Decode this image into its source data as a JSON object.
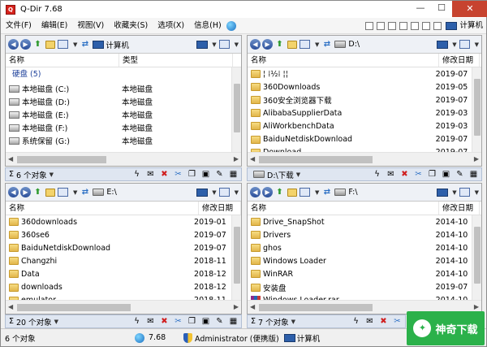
{
  "window": {
    "title": "Q-Dir 7.68",
    "close_glyph": "✕",
    "min_glyph": "—",
    "max_glyph": "☐"
  },
  "menu": [
    "文件(F)",
    "编辑(E)",
    "视图(V)",
    "收藏夹(S)",
    "选项(X)",
    "信息(H)"
  ],
  "menu_right_label": "计算机",
  "panes": [
    {
      "id": "top-left",
      "path": "计算机",
      "columns": [
        "名称",
        "类型"
      ],
      "group": "硬盘 (5)",
      "rows": [
        [
          "本地磁盘 (C:)",
          "本地磁盘"
        ],
        [
          "本地磁盘 (D:)",
          "本地磁盘"
        ],
        [
          "本地磁盘 (E:)",
          "本地磁盘"
        ],
        [
          "本地磁盘 (F:)",
          "本地磁盘"
        ],
        [
          "系统保留 (G:)",
          "本地磁盘"
        ]
      ],
      "status": "6 个对象"
    },
    {
      "id": "top-right",
      "path": "D:\\",
      "columns": [
        "名称",
        "修改日期"
      ],
      "rows": [
        [
          "¦ ⁞½⁞ ¦¦",
          "2019-07"
        ],
        [
          "360Downloads",
          "2019-05"
        ],
        [
          "360安全浏览器下载",
          "2019-07"
        ],
        [
          "AlibabaSupplierData",
          "2019-03"
        ],
        [
          "AliWorkbenchData",
          "2019-03"
        ],
        [
          "BaiduNetdiskDownload",
          "2019-07"
        ],
        [
          "Download",
          "2019-07"
        ]
      ],
      "status": "D:\\下载"
    },
    {
      "id": "bottom-left",
      "path": "E:\\",
      "columns": [
        "名称",
        "修改日期"
      ],
      "rows": [
        [
          "360downloads",
          "2019-01"
        ],
        [
          "360se6",
          "2019-07"
        ],
        [
          "BaiduNetdiskDownload",
          "2019-07"
        ],
        [
          "Changzhi",
          "2018-11"
        ],
        [
          "Data",
          "2018-12"
        ],
        [
          "downloads",
          "2018-12"
        ],
        [
          "emulator",
          "2018-11"
        ]
      ],
      "status": "20 个对象"
    },
    {
      "id": "bottom-right",
      "path": "F:\\",
      "columns": [
        "名称",
        "修改日期"
      ],
      "rows": [
        [
          "Drive_SnapShot",
          "2014-10"
        ],
        [
          "Drivers",
          "2014-10"
        ],
        [
          "ghos",
          "2014-10"
        ],
        [
          "Windows Loader",
          "2014-10"
        ],
        [
          "WinRAR",
          "2014-10"
        ],
        [
          "安装盘",
          "2019-07"
        ],
        [
          "Windows Loader.rar",
          "2014-10"
        ]
      ],
      "status": "7 个对象"
    }
  ],
  "statusbar": {
    "count": "6 个对象",
    "version": "7.68",
    "user": "Administrator (便携版)",
    "location": "计算机"
  },
  "brand": {
    "text": "神奇下载"
  }
}
